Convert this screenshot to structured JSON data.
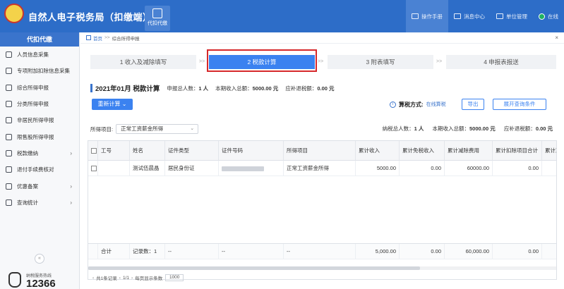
{
  "app": {
    "title": "自然人电子税务局（扣缴端）",
    "active_module": "代扣代缴",
    "top_actions": [
      {
        "label": "操作手册",
        "icon": "book-icon"
      },
      {
        "label": "消息中心",
        "icon": "mail-icon"
      },
      {
        "label": "单位管理",
        "icon": "building-icon"
      },
      {
        "label": "在线",
        "icon": "online-status-icon"
      }
    ]
  },
  "sidebar": {
    "header": "代扣代缴",
    "items": [
      {
        "label": "人员信息采集",
        "icon": "person-icon",
        "has_children": false
      },
      {
        "label": "专项附加扣除信息采集",
        "icon": "clipboard-icon",
        "has_children": false
      },
      {
        "label": "综合所得申报",
        "icon": "chart-icon",
        "has_children": false
      },
      {
        "label": "分类所得申报",
        "icon": "grid-icon",
        "has_children": false
      },
      {
        "label": "非居民所得申报",
        "icon": "globe-icon",
        "has_children": false
      },
      {
        "label": "限售股所得申报",
        "icon": "lock-icon",
        "has_children": false
      },
      {
        "label": "税款缴纳",
        "icon": "money-icon",
        "has_children": true
      },
      {
        "label": "退付手续费核对",
        "icon": "refund-icon",
        "has_children": false
      },
      {
        "label": "优惠备案",
        "icon": "gift-icon",
        "has_children": true
      },
      {
        "label": "查询统计",
        "icon": "search-icon",
        "has_children": true
      }
    ],
    "collapse_glyph": "«",
    "hotline": {
      "label": "纳税服务热线",
      "number": "12366"
    }
  },
  "breadcrumb": {
    "home": "首页",
    "separator": ">>",
    "current": "综合所得申报"
  },
  "steps": [
    {
      "label": "1 收入及减除填写",
      "active": false
    },
    {
      "label": "2 税款计算",
      "active": true
    },
    {
      "label": "3 附表填写",
      "active": false
    },
    {
      "label": "4 申报表报送",
      "active": false
    }
  ],
  "step_arrow": ">>",
  "period": {
    "title": "2021年01月  税款计算",
    "total_people_label": "申报总人数：",
    "total_people_value": "1 人",
    "total_income_label": "本期收入总额：",
    "total_income_value": "5000.00 元",
    "refund_label": "应补退税额：",
    "refund_value": "0.00 元"
  },
  "actions": {
    "recalc": "重新计算",
    "calc_method_label": "算税方式:",
    "calc_method_value": "在线算税",
    "export": "导出",
    "expand_query": "展开查询条件"
  },
  "filter": {
    "label": "所得项目:",
    "selected": "正常工资薪金所得"
  },
  "summary": {
    "people_label": "纳税总人数：",
    "people_value": "1 人",
    "income_label": "本期收入总额：",
    "income_value": "5000.00 元",
    "refund_label": "应补退税额：",
    "refund_value": "0.00 元"
  },
  "table": {
    "columns": [
      "",
      "工号",
      "姓名",
      "证件类型",
      "证件号码",
      "所得项目",
      "累计收入",
      "累计免税收入",
      "累计减除费用",
      "累计扣除项目合计",
      "累计准"
    ],
    "rows": [
      {
        "id": "",
        "name": "测试伍晨晶",
        "id_type": "居民身份证",
        "id_number": "",
        "income_item": "正常工资薪金所得",
        "cum_income": "5000.00",
        "cum_tax_free": "0.00",
        "cum_deduction": "60000.00",
        "cum_deduct_total": "0.00"
      }
    ],
    "footer": {
      "label": "合计",
      "record_count": "记录数：1",
      "dash": "--",
      "cum_income": "5,000.00",
      "cum_tax_free": "0.00",
      "cum_deduction": "60,000.00",
      "cum_deduct_total": "0.00"
    }
  },
  "pager": {
    "total_records": "共1条记录",
    "page": "1/1",
    "page_size_label": "每页显示条数",
    "page_size": "1000"
  }
}
